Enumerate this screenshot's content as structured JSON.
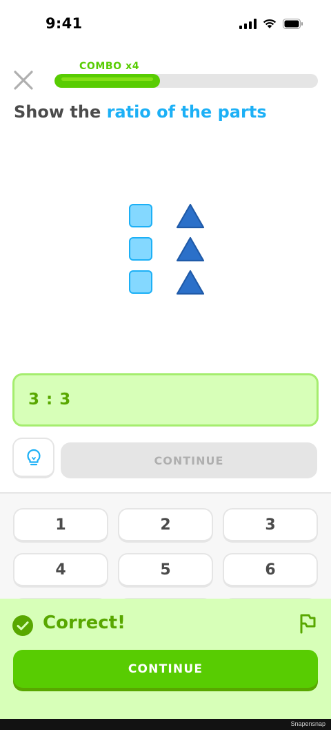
{
  "status_bar": {
    "time": "9:41"
  },
  "header": {
    "combo_label": "COMBO x4",
    "progress": 0.4
  },
  "prompt": {
    "prefix": "Show the ",
    "highlight": "ratio of the parts"
  },
  "figure": {
    "squares": 3,
    "triangles": 3
  },
  "answer": {
    "value": "3 : 3"
  },
  "buttons": {
    "continue_disabled": "CONTINUE",
    "continue_primary": "CONTINUE"
  },
  "keypad": {
    "keys": [
      "1",
      "2",
      "3",
      "4",
      "5",
      "6"
    ]
  },
  "feedback": {
    "message": "Correct!"
  },
  "footer": {
    "watermark": "Snapensnap"
  },
  "colors": {
    "green": "#58cc02",
    "green_dark": "#58a700",
    "green_light": "#d7ffb8",
    "blue": "#1cb0f6",
    "blue_dark": "#2b70c9"
  }
}
